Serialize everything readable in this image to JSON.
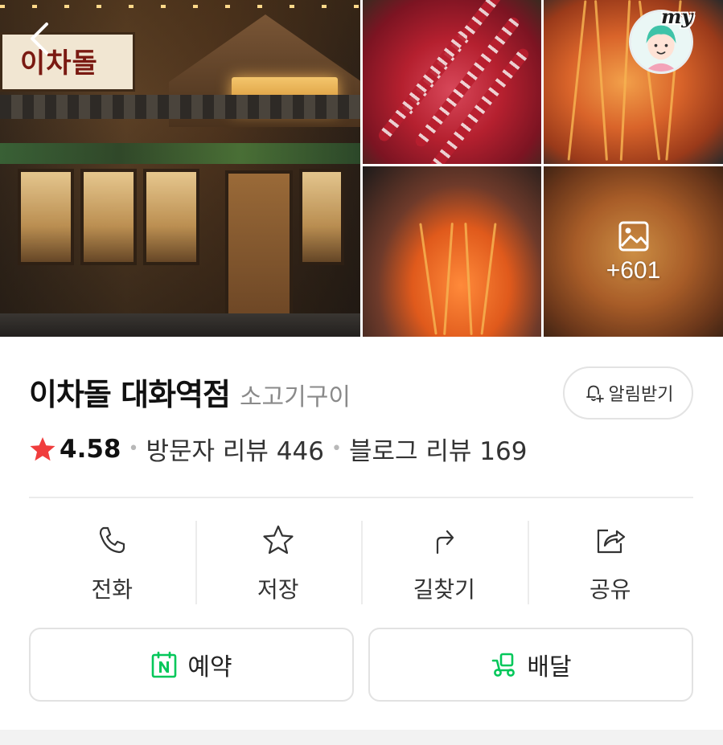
{
  "header": {
    "my_label": "my",
    "more_photos_count": "+601",
    "storefront_sign": "이차돌"
  },
  "place": {
    "name": "이차돌 대화역점",
    "category": "소고기구이",
    "notify_label": "알림받기",
    "rating": "4.58",
    "visitor_reviews": "방문자 리뷰 446",
    "blog_reviews": "블로그 리뷰 169"
  },
  "actions": [
    {
      "label": "전화",
      "icon": "phone-icon"
    },
    {
      "label": "저장",
      "icon": "star-outline-icon"
    },
    {
      "label": "길찾기",
      "icon": "directions-icon"
    },
    {
      "label": "공유",
      "icon": "share-icon"
    }
  ],
  "buttons": {
    "reserve_label": "예약",
    "delivery_label": "배달"
  },
  "colors": {
    "star": "#f03d3d",
    "naver_green": "#03c75a"
  }
}
